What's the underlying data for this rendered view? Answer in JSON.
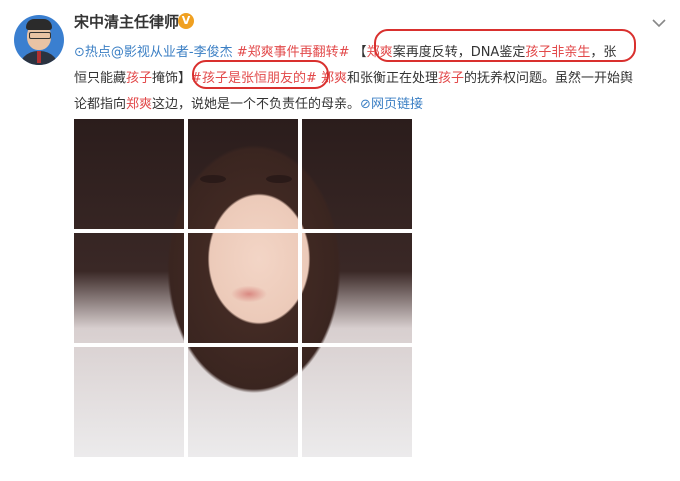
{
  "user": {
    "name": "宋中清主任律师",
    "badge": "V"
  },
  "post": {
    "location_icon": "location-pin-icon",
    "line1": {
      "seg1": "热点@影视从业者-李俊杰 ",
      "seg2": "#郑爽事件再翻转#",
      "seg3": " 【",
      "seg4": "郑爽",
      "seg5": "案再度反转，DNA鉴定",
      "seg6": "孩子非亲生",
      "seg7": "，张"
    },
    "line2": {
      "seg1": "恒只能藏",
      "seg2": "孩子",
      "seg3": "掩饰】",
      "seg4": "#孩子是张恒朋友的#",
      "seg5": " ",
      "seg6": "郑爽",
      "seg7": "和张衡正在处理",
      "seg8": "孩子",
      "seg9": "的抚养权问题。虽然一开始舆"
    },
    "line3": {
      "seg1": "论都指向",
      "seg2": "郑爽",
      "seg3": "这边，说她是一个不负责任的母亲。",
      "seg4": "网页链接"
    }
  },
  "colors": {
    "highlight": "#e2494a",
    "link": "#3b7fc4",
    "circle": "#d9302e",
    "badge": "#f0a020"
  },
  "images": {
    "count": 9,
    "description": "photo grid"
  }
}
